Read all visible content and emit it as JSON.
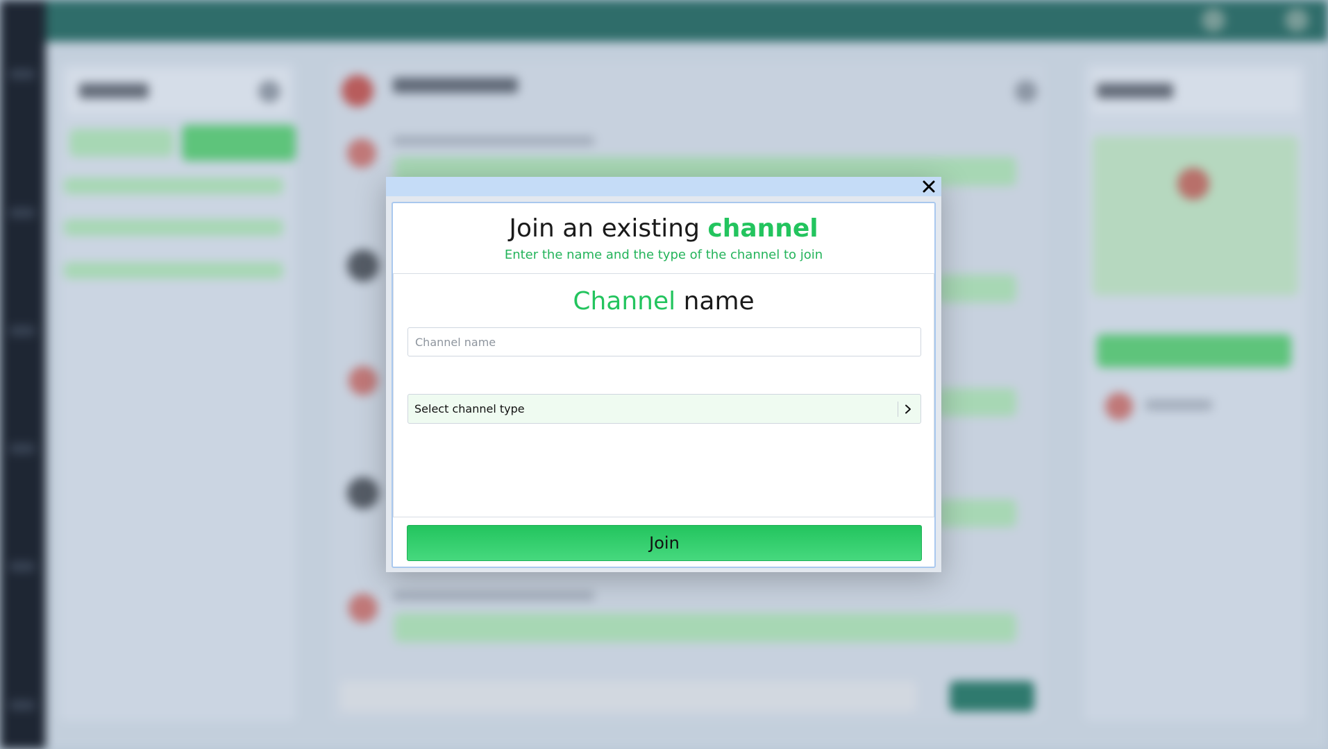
{
  "modal": {
    "close_icon": "close-icon",
    "title_prefix": "Join an existing ",
    "title_accent": "channel",
    "subtitle": "Enter the name and the type of the channel to join",
    "section_accent": "Channel",
    "section_rest": " name",
    "channel_name_placeholder": "Channel name",
    "channel_name_value": "",
    "channel_type_label": "Select channel type",
    "channel_type_icon": "chevron-right-icon",
    "join_label": "Join"
  },
  "colors": {
    "accent_green": "#23c45e",
    "titlebar": "#c5dcf7",
    "overlay_background": "#c3cfdc"
  }
}
